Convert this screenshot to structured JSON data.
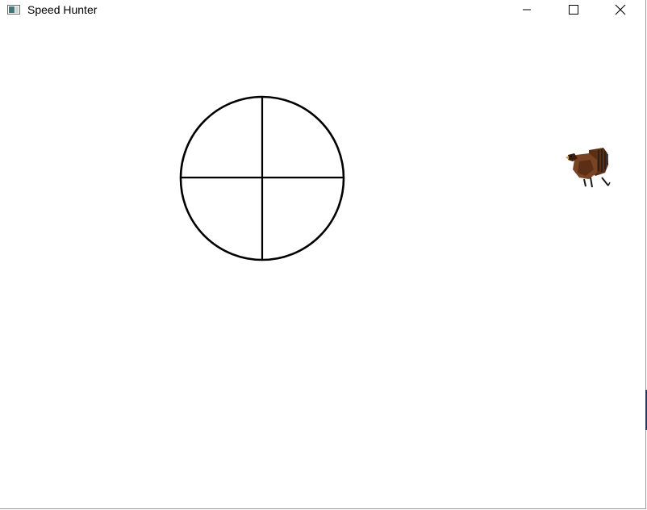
{
  "window": {
    "title": "Speed Hunter",
    "controls": {
      "minimize_icon": "minimize-icon",
      "maximize_icon": "maximize-icon",
      "close_icon": "close-icon"
    }
  },
  "game": {
    "background_color": "#ffffff",
    "crosshair_color": "#000000",
    "target": {
      "icon": "turkey-icon",
      "colors": [
        "#5a2f16",
        "#7a4424",
        "#3a1d0c",
        "#1a1a1a"
      ]
    }
  }
}
